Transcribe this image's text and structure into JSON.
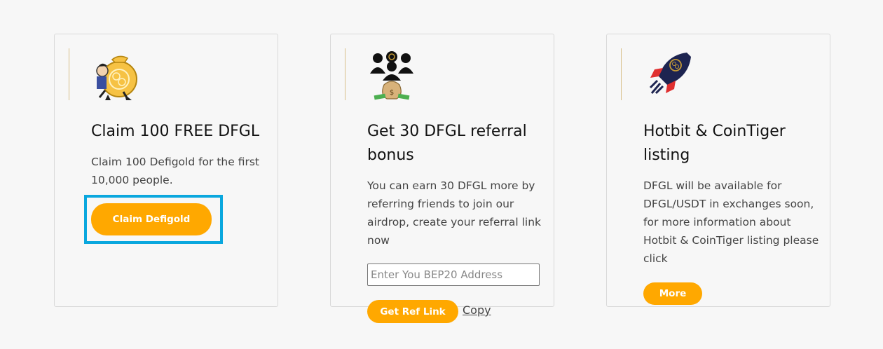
{
  "cards": [
    {
      "title": "Claim 100 FREE DFGL",
      "description": "Claim 100 Defigold for the first 10,000 people.",
      "button_label": "Claim Defigold",
      "icon": "moneybag-man-icon"
    },
    {
      "title": "Get 30 DFGL referral bonus",
      "description": "You can earn 30 DFGL more by referring friends to join our airdrop, create your referral link now",
      "input_placeholder": "Enter You BEP20 Address",
      "button_label": "Get Ref Link",
      "copy_label": "Copy",
      "icon": "referral-people-icon"
    },
    {
      "title": "Hotbit & CoinTiger listing",
      "description": "DFGL will be available for DFGL/USDT in exchanges soon, for more information about Hotbit & CoinTiger listing please click",
      "button_label": "More",
      "icon": "rocket-icon"
    }
  ],
  "colors": {
    "accent": "#ffa800",
    "highlight": "#0aa7de",
    "card_border": "#d9d9d9"
  }
}
